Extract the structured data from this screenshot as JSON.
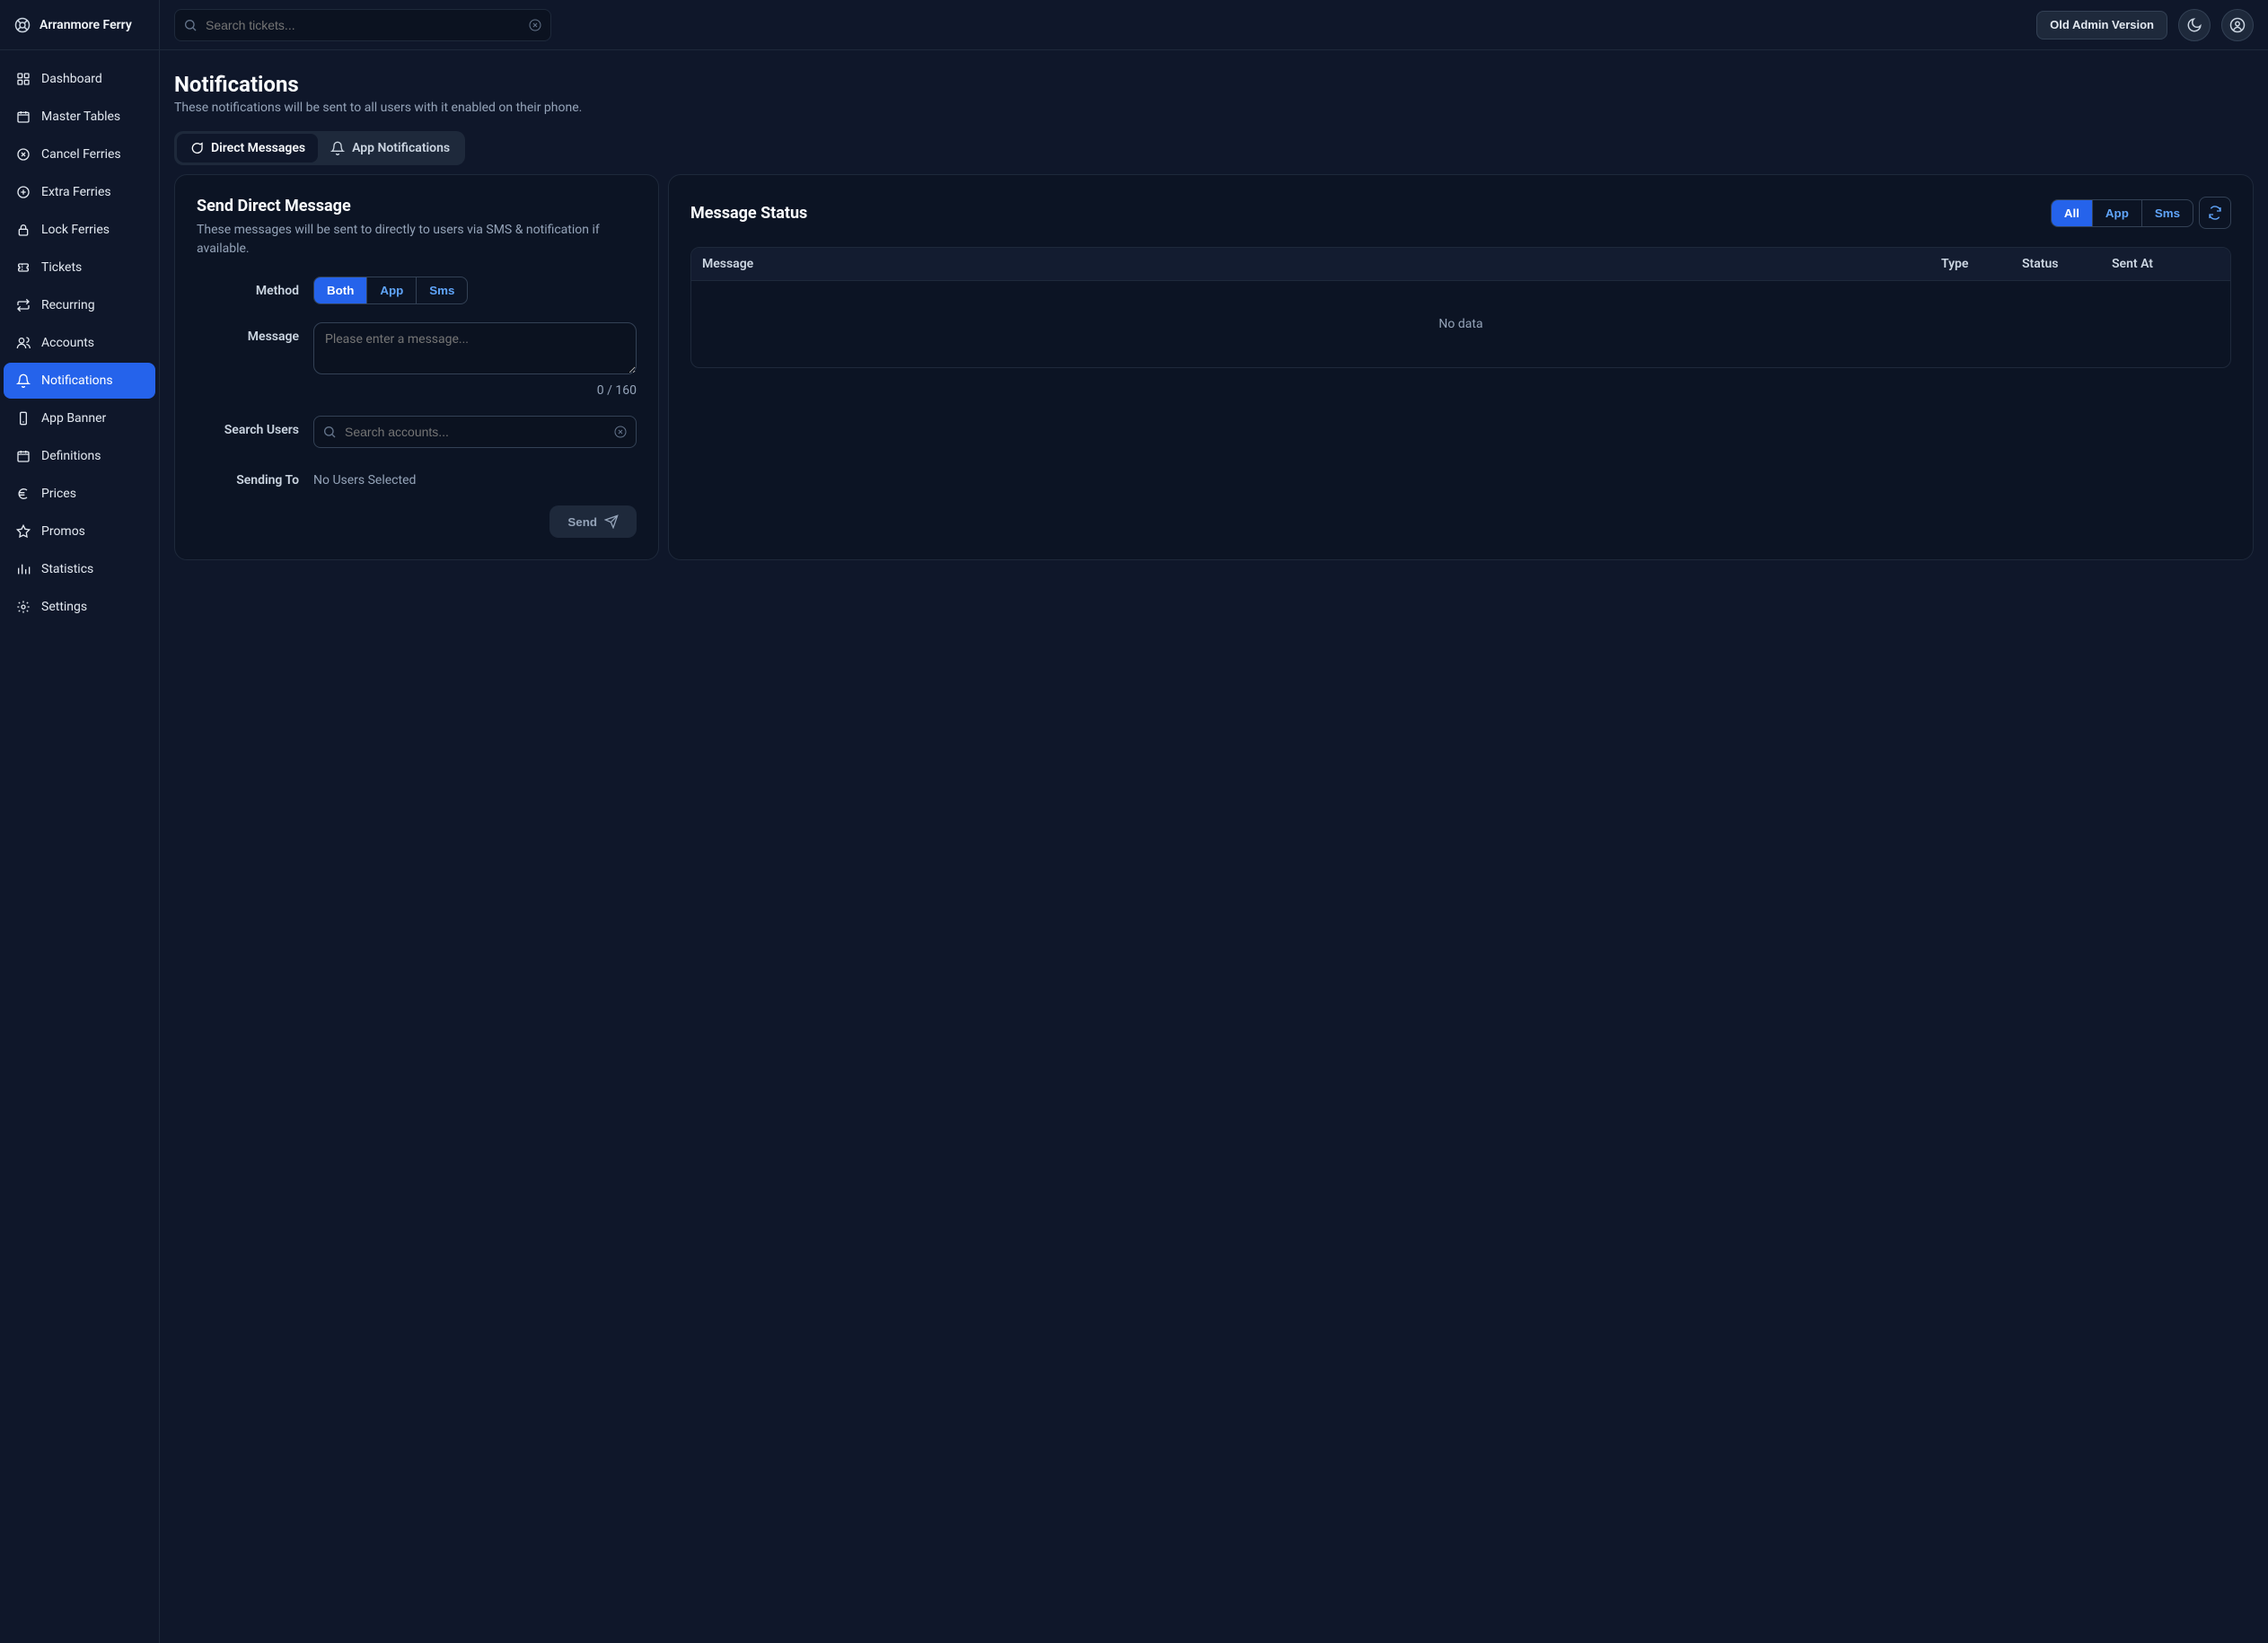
{
  "brand": "Arranmore Ferry",
  "topbar": {
    "search_placeholder": "Search tickets...",
    "old_admin_label": "Old Admin Version"
  },
  "nav": [
    {
      "key": "dashboard",
      "label": "Dashboard",
      "icon": "grid"
    },
    {
      "key": "master-tables",
      "label": "Master Tables",
      "icon": "calendar"
    },
    {
      "key": "cancel-ferries",
      "label": "Cancel Ferries",
      "icon": "x-circle"
    },
    {
      "key": "extra-ferries",
      "label": "Extra Ferries",
      "icon": "plus-circle"
    },
    {
      "key": "lock-ferries",
      "label": "Lock Ferries",
      "icon": "lock"
    },
    {
      "key": "tickets",
      "label": "Tickets",
      "icon": "ticket"
    },
    {
      "key": "recurring",
      "label": "Recurring",
      "icon": "repeat"
    },
    {
      "key": "accounts",
      "label": "Accounts",
      "icon": "users"
    },
    {
      "key": "notifications",
      "label": "Notifications",
      "icon": "bell",
      "active": true
    },
    {
      "key": "app-banner",
      "label": "App Banner",
      "icon": "phone"
    },
    {
      "key": "definitions",
      "label": "Definitions",
      "icon": "calendar"
    },
    {
      "key": "prices",
      "label": "Prices",
      "icon": "euro"
    },
    {
      "key": "promos",
      "label": "Promos",
      "icon": "star"
    },
    {
      "key": "statistics",
      "label": "Statistics",
      "icon": "bar"
    },
    {
      "key": "settings",
      "label": "Settings",
      "icon": "gear"
    }
  ],
  "page": {
    "title": "Notifications",
    "subtitle": "These notifications will be sent to all users with it enabled on their phone."
  },
  "tabs": {
    "direct": "Direct Messages",
    "app": "App Notifications"
  },
  "compose": {
    "title": "Send Direct Message",
    "subtitle": "These messages will be sent to directly to users via SMS & notification if available.",
    "method_label": "Method",
    "methods": {
      "both": "Both",
      "app": "App",
      "sms": "Sms"
    },
    "message_label": "Message",
    "message_placeholder": "Please enter a message...",
    "counter": "0 / 160",
    "search_label": "Search Users",
    "search_placeholder": "Search accounts...",
    "sending_label": "Sending To",
    "sending_value": "No Users Selected",
    "send_label": "Send"
  },
  "status": {
    "title": "Message Status",
    "filters": {
      "all": "All",
      "app": "App",
      "sms": "Sms"
    },
    "columns": {
      "message": "Message",
      "type": "Type",
      "status": "Status",
      "sent_at": "Sent At"
    },
    "empty": "No data"
  }
}
